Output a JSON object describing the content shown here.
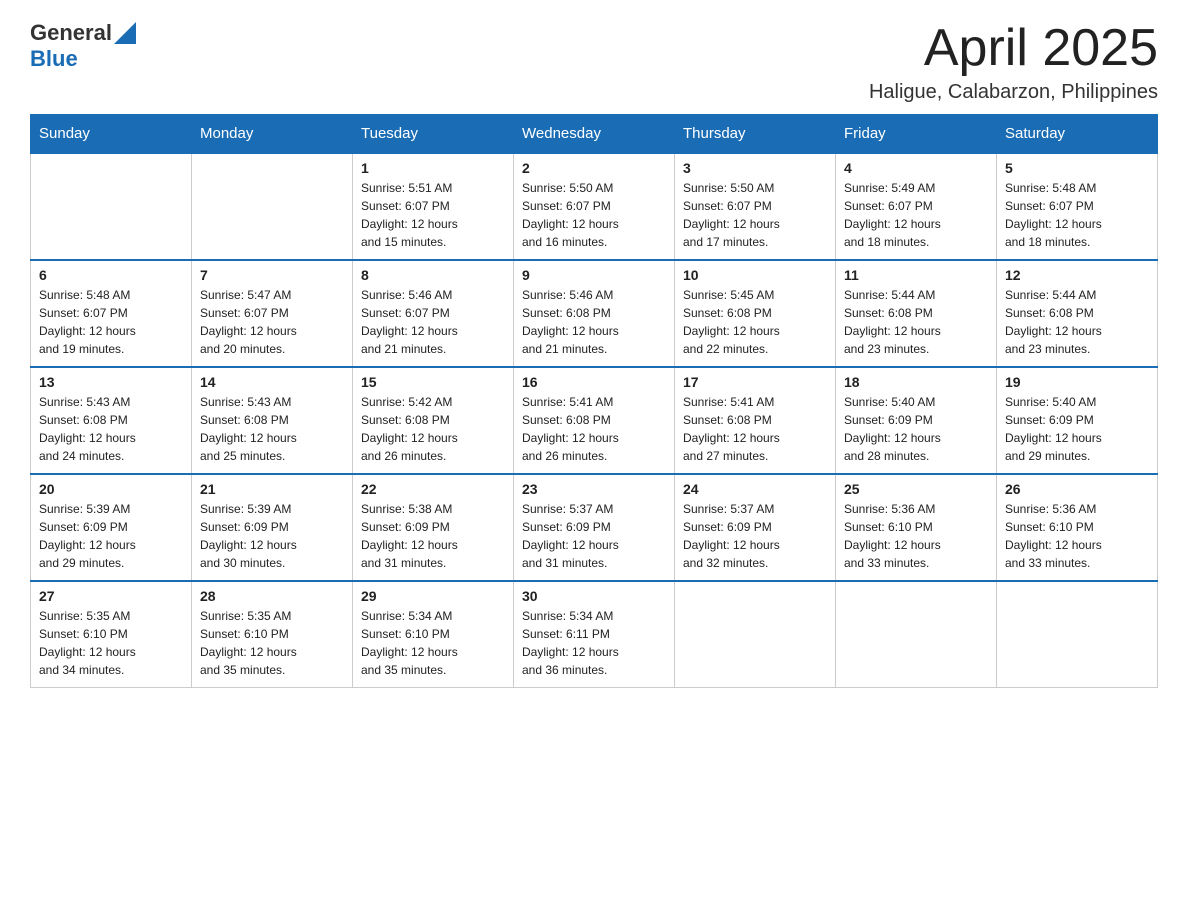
{
  "header": {
    "logo": {
      "text_general": "General",
      "text_blue": "Blue",
      "triangle_color": "#1a6db5"
    },
    "title": "April 2025",
    "location": "Haligue, Calabarzon, Philippines"
  },
  "calendar": {
    "headers": [
      "Sunday",
      "Monday",
      "Tuesday",
      "Wednesday",
      "Thursday",
      "Friday",
      "Saturday"
    ],
    "weeks": [
      [
        {
          "day": "",
          "info": ""
        },
        {
          "day": "",
          "info": ""
        },
        {
          "day": "1",
          "info": "Sunrise: 5:51 AM\nSunset: 6:07 PM\nDaylight: 12 hours\nand 15 minutes."
        },
        {
          "day": "2",
          "info": "Sunrise: 5:50 AM\nSunset: 6:07 PM\nDaylight: 12 hours\nand 16 minutes."
        },
        {
          "day": "3",
          "info": "Sunrise: 5:50 AM\nSunset: 6:07 PM\nDaylight: 12 hours\nand 17 minutes."
        },
        {
          "day": "4",
          "info": "Sunrise: 5:49 AM\nSunset: 6:07 PM\nDaylight: 12 hours\nand 18 minutes."
        },
        {
          "day": "5",
          "info": "Sunrise: 5:48 AM\nSunset: 6:07 PM\nDaylight: 12 hours\nand 18 minutes."
        }
      ],
      [
        {
          "day": "6",
          "info": "Sunrise: 5:48 AM\nSunset: 6:07 PM\nDaylight: 12 hours\nand 19 minutes."
        },
        {
          "day": "7",
          "info": "Sunrise: 5:47 AM\nSunset: 6:07 PM\nDaylight: 12 hours\nand 20 minutes."
        },
        {
          "day": "8",
          "info": "Sunrise: 5:46 AM\nSunset: 6:07 PM\nDaylight: 12 hours\nand 21 minutes."
        },
        {
          "day": "9",
          "info": "Sunrise: 5:46 AM\nSunset: 6:08 PM\nDaylight: 12 hours\nand 21 minutes."
        },
        {
          "day": "10",
          "info": "Sunrise: 5:45 AM\nSunset: 6:08 PM\nDaylight: 12 hours\nand 22 minutes."
        },
        {
          "day": "11",
          "info": "Sunrise: 5:44 AM\nSunset: 6:08 PM\nDaylight: 12 hours\nand 23 minutes."
        },
        {
          "day": "12",
          "info": "Sunrise: 5:44 AM\nSunset: 6:08 PM\nDaylight: 12 hours\nand 23 minutes."
        }
      ],
      [
        {
          "day": "13",
          "info": "Sunrise: 5:43 AM\nSunset: 6:08 PM\nDaylight: 12 hours\nand 24 minutes."
        },
        {
          "day": "14",
          "info": "Sunrise: 5:43 AM\nSunset: 6:08 PM\nDaylight: 12 hours\nand 25 minutes."
        },
        {
          "day": "15",
          "info": "Sunrise: 5:42 AM\nSunset: 6:08 PM\nDaylight: 12 hours\nand 26 minutes."
        },
        {
          "day": "16",
          "info": "Sunrise: 5:41 AM\nSunset: 6:08 PM\nDaylight: 12 hours\nand 26 minutes."
        },
        {
          "day": "17",
          "info": "Sunrise: 5:41 AM\nSunset: 6:08 PM\nDaylight: 12 hours\nand 27 minutes."
        },
        {
          "day": "18",
          "info": "Sunrise: 5:40 AM\nSunset: 6:09 PM\nDaylight: 12 hours\nand 28 minutes."
        },
        {
          "day": "19",
          "info": "Sunrise: 5:40 AM\nSunset: 6:09 PM\nDaylight: 12 hours\nand 29 minutes."
        }
      ],
      [
        {
          "day": "20",
          "info": "Sunrise: 5:39 AM\nSunset: 6:09 PM\nDaylight: 12 hours\nand 29 minutes."
        },
        {
          "day": "21",
          "info": "Sunrise: 5:39 AM\nSunset: 6:09 PM\nDaylight: 12 hours\nand 30 minutes."
        },
        {
          "day": "22",
          "info": "Sunrise: 5:38 AM\nSunset: 6:09 PM\nDaylight: 12 hours\nand 31 minutes."
        },
        {
          "day": "23",
          "info": "Sunrise: 5:37 AM\nSunset: 6:09 PM\nDaylight: 12 hours\nand 31 minutes."
        },
        {
          "day": "24",
          "info": "Sunrise: 5:37 AM\nSunset: 6:09 PM\nDaylight: 12 hours\nand 32 minutes."
        },
        {
          "day": "25",
          "info": "Sunrise: 5:36 AM\nSunset: 6:10 PM\nDaylight: 12 hours\nand 33 minutes."
        },
        {
          "day": "26",
          "info": "Sunrise: 5:36 AM\nSunset: 6:10 PM\nDaylight: 12 hours\nand 33 minutes."
        }
      ],
      [
        {
          "day": "27",
          "info": "Sunrise: 5:35 AM\nSunset: 6:10 PM\nDaylight: 12 hours\nand 34 minutes."
        },
        {
          "day": "28",
          "info": "Sunrise: 5:35 AM\nSunset: 6:10 PM\nDaylight: 12 hours\nand 35 minutes."
        },
        {
          "day": "29",
          "info": "Sunrise: 5:34 AM\nSunset: 6:10 PM\nDaylight: 12 hours\nand 35 minutes."
        },
        {
          "day": "30",
          "info": "Sunrise: 5:34 AM\nSunset: 6:11 PM\nDaylight: 12 hours\nand 36 minutes."
        },
        {
          "day": "",
          "info": ""
        },
        {
          "day": "",
          "info": ""
        },
        {
          "day": "",
          "info": ""
        }
      ]
    ]
  }
}
